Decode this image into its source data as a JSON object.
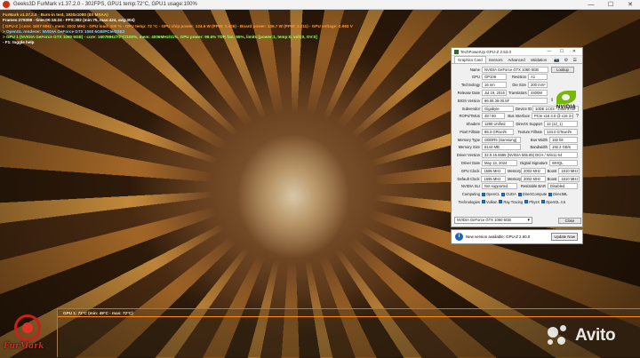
{
  "window": {
    "title": "Geeks3D FurMark v1.37.2.0 - 302FPS, GPU1 temp:72°C, GPU1 usage:100%",
    "minimize": "—",
    "maximize": "☐",
    "close": "✕"
  },
  "hud": {
    "line1": "FurMark v1.37.2.0 - Burn-in test, 1920x1080 (8X MSAA)",
    "line2": "Frames:279398 - time:00:15:24 - FPS:302 (min:75, max:424, avg:304)",
    "line3": "[ GPU-Z ] core: 1607 MHz - mem: 2002 MHz - GPU load: 100 % - GPU temp: 72 °C - GPU chip power: 124.6 W (PPW: 2.426) - Board power: 136.7 W (PPW: 2.211) - GPU voltage: 0.993 V",
    "line4": "> OpenGL renderer: NVIDIA GeForce GTX 1060 6GB/PCIe/SSE2",
    "line5": "> GPU 1 (NVIDIA GeForce GTX 1060 6GB) - core: 1607MHz/72°C/100%, mem: 4006MHz/11%, GPU power: 99.6% TDP, fan: 55%, limits:[power:1, temp:0, volt:0, OV:0]",
    "line6": "- F1: toggle help"
  },
  "gpuz": {
    "title": "TechPowerUp GPU-Z 2.53.0",
    "tabs": [
      "Graphics Card",
      "Sensors",
      "Advanced",
      "Validation"
    ],
    "tab_icons": "📷 ⚙ ☰",
    "name_label": "Name",
    "name": "NVIDIA GeForce GTX 1060 6GB",
    "lookup": "Lookup",
    "gpu_label": "GPU",
    "gpu": "GP106",
    "revision_label": "Revision",
    "revision": "A1",
    "tech_label": "Technology",
    "tech": "16 nm",
    "diesize_label": "Die Size",
    "diesize": "200 mm²",
    "release_label": "Release Date",
    "release": "Jul 19, 2016",
    "transistors_label": "Transistors",
    "transistors": "4400M",
    "bios_label": "BIOS Version",
    "bios": "86.06.39.00.5F",
    "uefi": "UEFI",
    "subvendor_label": "Subvendor",
    "subvendor": "Gigabyte",
    "deviceid_label": "Device ID",
    "deviceid": "10DE 1C03 - 1458 3739",
    "rops_label": "ROPs/TMUs",
    "rops": "48 / 80",
    "bus_label": "Bus Interface",
    "bus": "PCIe x16 3.0 @ x16 3.0",
    "bus_help": "?",
    "shaders_label": "Shaders",
    "shaders": "1280 Unified",
    "directx_label": "DirectX Support",
    "directx": "12 (12_1)",
    "pixel_label": "Pixel Fillrate",
    "pixel": "86.3 GPixel/s",
    "texture_label": "Texture Fillrate",
    "texture": "144.0 GTexel/s",
    "memtype_label": "Memory Type",
    "memtype": "GDDR5 (Samsung)",
    "buswidth_label": "Bus Width",
    "buswidth": "192 bit",
    "memsize_label": "Memory Size",
    "memsize": "6144 MB",
    "bandwidth_label": "Bandwidth",
    "bandwidth": "192.2 GB/s",
    "driverver_label": "Driver Version",
    "driverver": "32.0.15.5585 (NVIDIA 555.85) DCH / Win11 64",
    "driverdate_label": "Driver Date",
    "driverdate": "May 13, 2024",
    "digsig_label": "Digital Signature",
    "digsig": "WHQL",
    "gpuclock_label": "GPU Clock",
    "gpuclock": "1595 MHz",
    "memory_label": "Memory",
    "gpumem": "2002 MHz",
    "boost_label": "Boost",
    "boost": "1810 MHz",
    "defclock_label": "Default Clock",
    "defclock": "1595 MHz",
    "defmem": "2002 MHz",
    "defboost": "1810 MHz",
    "sli_label": "NVIDIA SLI",
    "sli": "Not supported",
    "rebar_label": "Resizable BAR",
    "rebar": "Disabled",
    "computing_label": "Computing",
    "computing": [
      "OpenCL",
      "CUDA",
      "DirectCompute",
      "DirectML"
    ],
    "technologies_label": "Technologies",
    "technologies": [
      "Vulkan",
      "Ray Tracing",
      "PhysX",
      "OpenGL 4.6"
    ],
    "selected_gpu": "NVIDIA GeForce GTX 1060 6GB",
    "close": "Close",
    "nvidia_word": "NVIDIA"
  },
  "notify": {
    "text": "New version available: GPU-Z 2.60.0",
    "button": "Update Now",
    "icon": "i"
  },
  "graph": {
    "label": "GPU 1: 72°C (min: 49°C - max: 72°C)"
  },
  "furmark_logo": "FurMark",
  "watermark": "Avito",
  "colors": {
    "hud_yellow": "#ffcf2e",
    "graph_line": "#ff8a1a",
    "checkbox_blue": "#1f6fd0",
    "nvidia_green": "#76b900"
  }
}
